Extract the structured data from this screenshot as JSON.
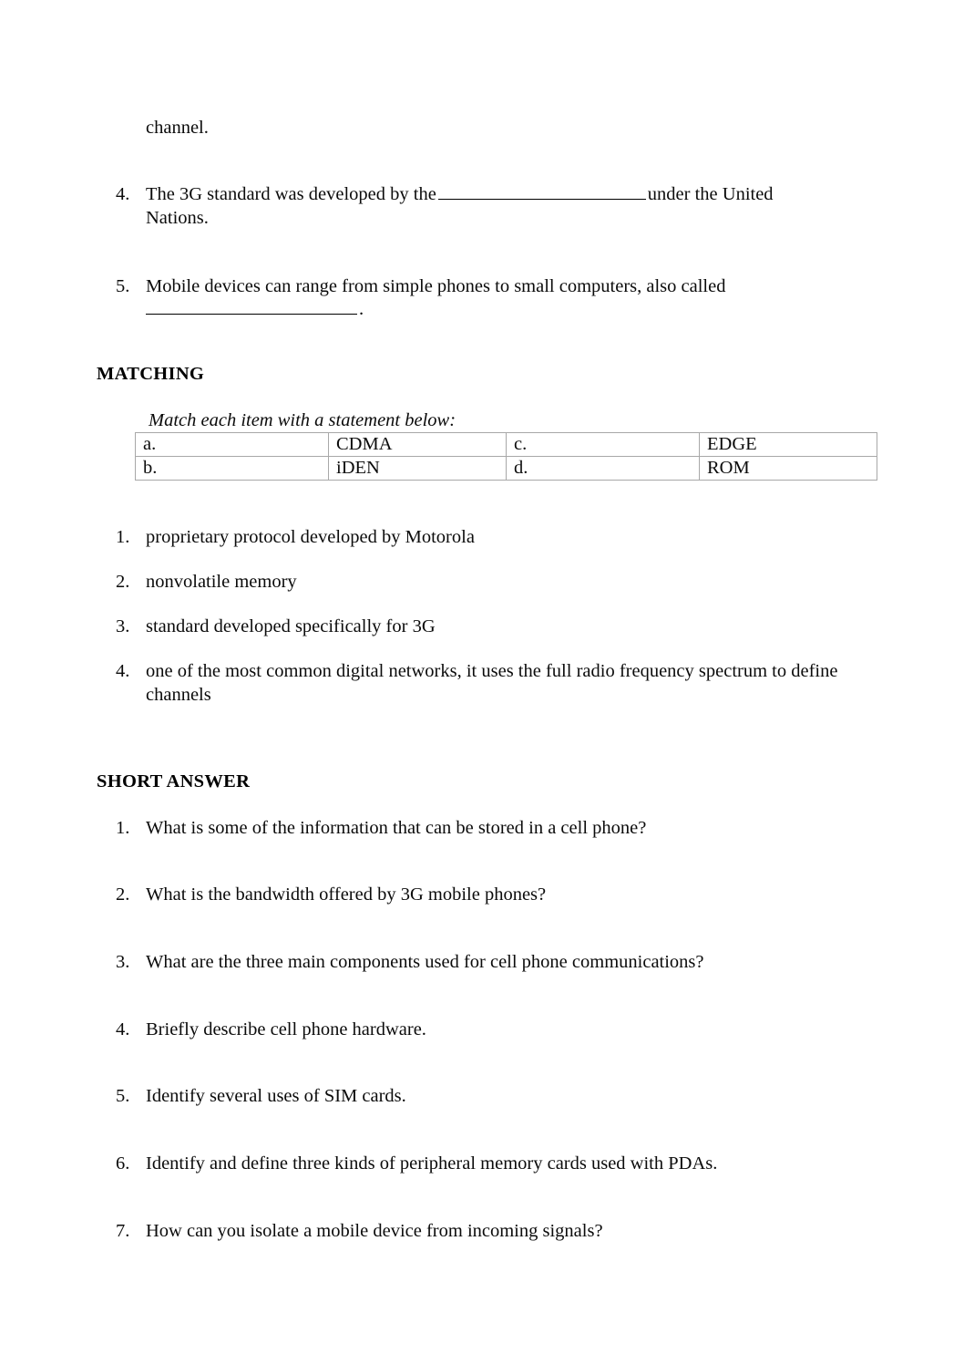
{
  "document": {
    "continued_line": "channel.",
    "completion_items": [
      {
        "number": "4.",
        "text_before": "The 3G standard was developed by the",
        "blank": true,
        "text_after": "under the United Nations."
      },
      {
        "number": "5.",
        "text_before": "Mobile devices can range from simple phones to small computers, also called",
        "blank": true,
        "text_after": "."
      }
    ],
    "matching": {
      "heading": "MATCHING",
      "instruction": "Match each item with a statement below:",
      "table": {
        "rows": [
          [
            "a.",
            "CDMA",
            "c.",
            "EDGE"
          ],
          [
            "b.",
            "iDEN",
            "d.",
            "ROM"
          ]
        ]
      },
      "items": [
        {
          "number": "1.",
          "text": "proprietary protocol developed by Motorola"
        },
        {
          "number": "2.",
          "text": "nonvolatile memory"
        },
        {
          "number": "3.",
          "text": "standard developed specifically for 3G"
        },
        {
          "number": "4.",
          "text": "one of the most common digital networks, it uses the full radio frequency spectrum to define channels"
        }
      ]
    },
    "short_answer": {
      "heading": "SHORT ANSWER",
      "items": [
        {
          "number": "1.",
          "text": "What is some of the information that can be stored in a cell phone?"
        },
        {
          "number": "2.",
          "text": "What is the bandwidth offered by 3G mobile phones?"
        },
        {
          "number": "3.",
          "text": "What are the three main components used for cell phone communications?"
        },
        {
          "number": "4.",
          "text": "Briefly describe cell phone hardware."
        },
        {
          "number": "5.",
          "text": "Identify several uses of SIM cards."
        },
        {
          "number": "6.",
          "text": "Identify and define three kinds of peripheral memory cards used with PDAs."
        },
        {
          "number": "7.",
          "text": "How can you isolate a mobile device from incoming signals?"
        }
      ]
    }
  }
}
